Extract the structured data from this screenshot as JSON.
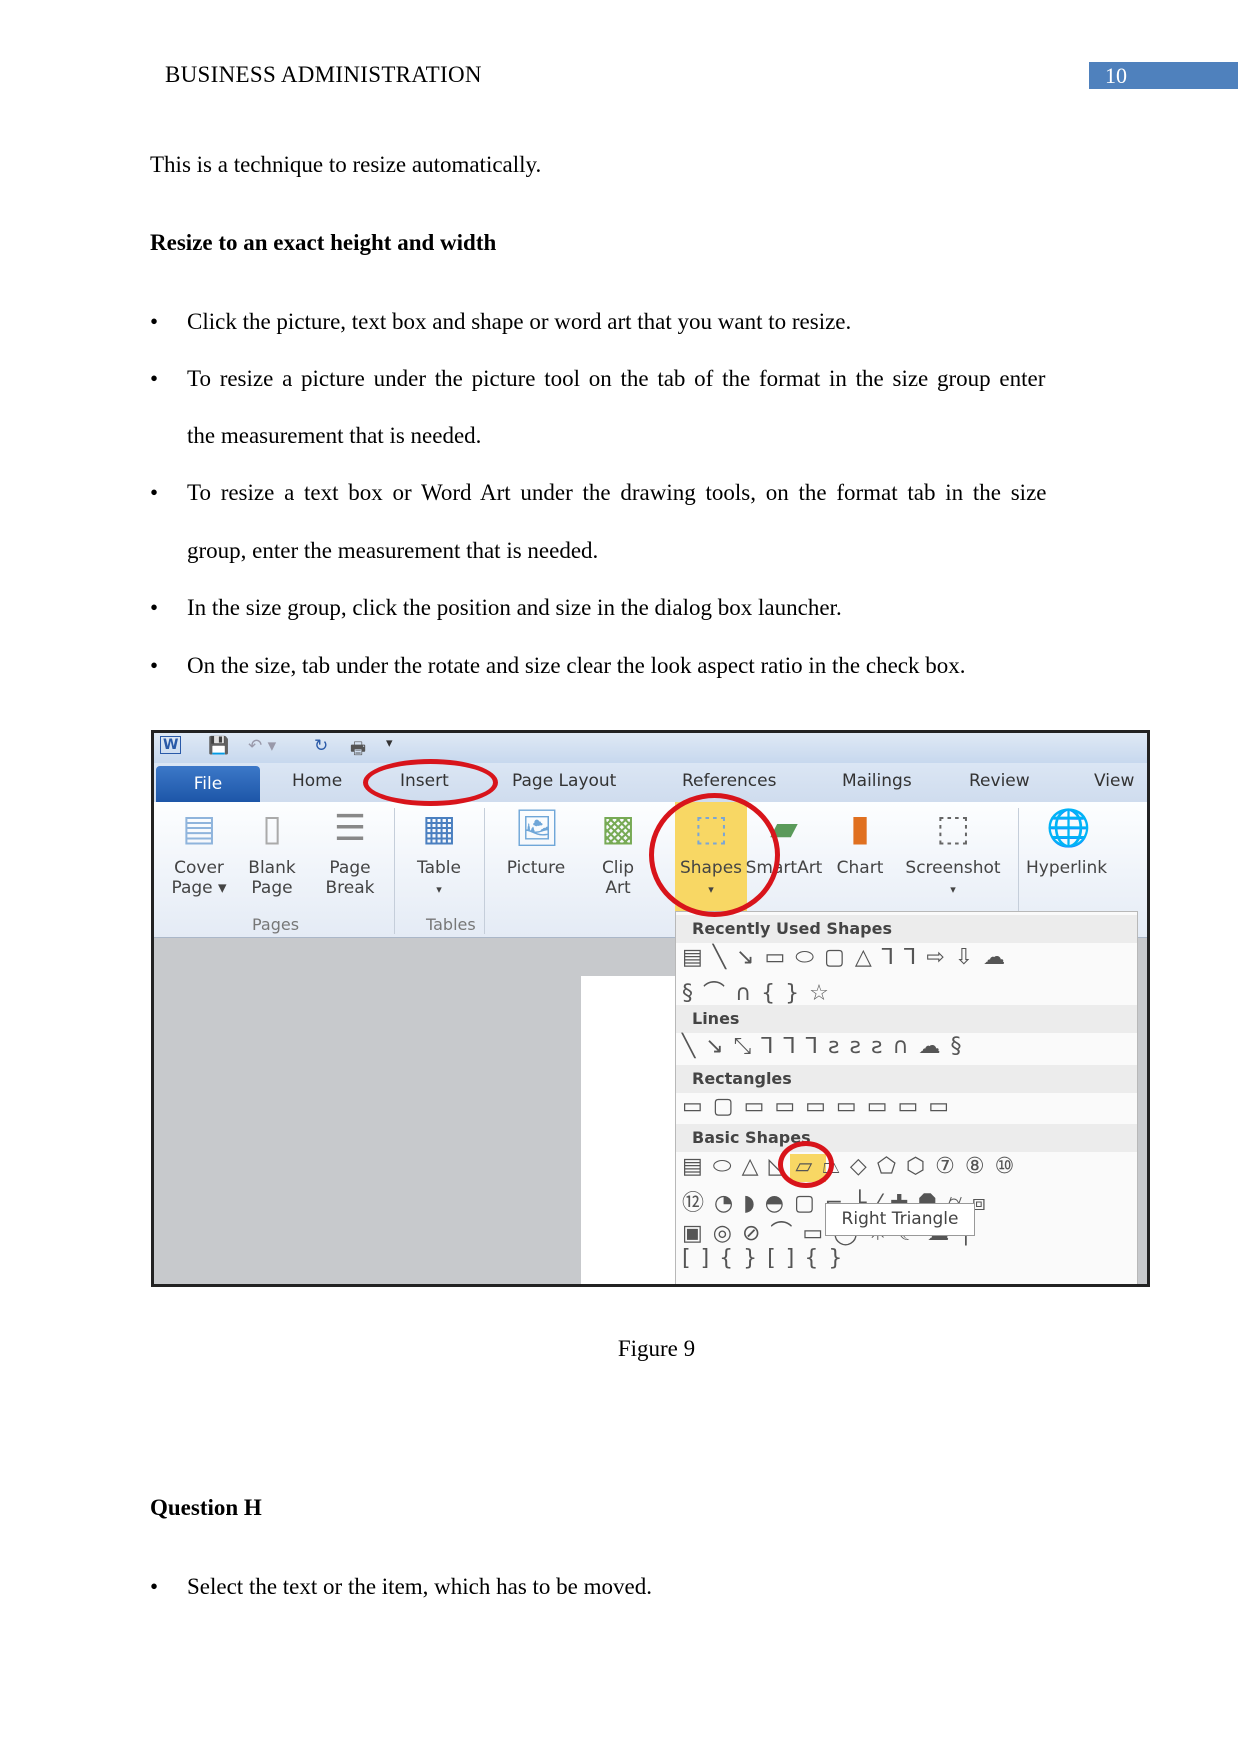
{
  "header": {
    "title": "BUSINESS ADMINISTRATION",
    "page_number": "10"
  },
  "intro": "This is a technique to resize automatically.",
  "heading1": "Resize to an exact height and width",
  "bullets": [
    {
      "lines": [
        "Click the picture, text box and shape or word art that you want to resize."
      ]
    },
    {
      "lines": [
        "To resize a picture under the picture tool on the tab of the format in the size group enter",
        "the measurement that is needed."
      ]
    },
    {
      "lines": [
        "To resize a text box or Word Art under the drawing tools, on the format tab in the size",
        "group, enter the measurement that is needed."
      ]
    },
    {
      "lines": [
        "In the size group, click the position and size in the dialog box launcher."
      ]
    },
    {
      "lines": [
        "On the size, tab under the rotate and size clear the look aspect ratio in the check box."
      ]
    }
  ],
  "figure": {
    "tabs": [
      "File",
      "Home",
      "Insert",
      "Page Layout",
      "References",
      "Mailings",
      "Review",
      "View"
    ],
    "buttons": [
      {
        "l1": "Cover",
        "l2": "Page ▾",
        "icon": "cover-page-icon"
      },
      {
        "l1": "Blank",
        "l2": "Page",
        "icon": "blank-page-icon"
      },
      {
        "l1": "Page",
        "l2": "Break",
        "icon": "page-break-icon"
      },
      {
        "l1": "Table",
        "l2": "▾",
        "icon": "table-icon"
      },
      {
        "l1": "Picture",
        "l2": "",
        "icon": "picture-icon"
      },
      {
        "l1": "Clip",
        "l2": "Art",
        "icon": "clip-art-icon"
      },
      {
        "l1": "Shapes",
        "l2": "▾",
        "icon": "shapes-icon"
      },
      {
        "l1": "SmartArt",
        "l2": "",
        "icon": "smartart-icon"
      },
      {
        "l1": "Chart",
        "l2": "",
        "icon": "chart-icon"
      },
      {
        "l1": "Screenshot",
        "l2": "▾",
        "icon": "screenshot-icon"
      },
      {
        "l1": "Hyperlink",
        "l2": "",
        "icon": "hyperlink-icon"
      }
    ],
    "groups": [
      "Pages",
      "Tables"
    ],
    "gallery": {
      "recent": "Recently Used Shapes",
      "lines": "Lines",
      "rectangles": "Rectangles",
      "basic": "Basic Shapes",
      "rows": {
        "recent1": "▤╲↘▭⬭▢△⅂⅂⇨⇩☁",
        "recent2": "§⌒∩{}☆",
        "lines1": "╲↘⤡⅂⅂⅂ƨƨƨ∩☁§",
        "rect1": "▭▢▭▭▭▭▭▭▭",
        "basic1": "▤⬭△◺▱⏢◇⬠⬡⑦⑧⑩",
        "basic2": "⑫◔◗◓▢⌐└⁄✚⯃⌭⧈",
        "basic3": "▣◎⊘⌒▭◯☼☾☁╮",
        "basic4": "[]{}[]{}"
      }
    },
    "tooltip": "Right Triangle",
    "highlight_color": "#f8d764",
    "annotation_color": "#d8141b"
  },
  "caption": "Figure 9",
  "heading2": "Question H",
  "bullets2": [
    "Select the text or the item, which has to be moved."
  ]
}
